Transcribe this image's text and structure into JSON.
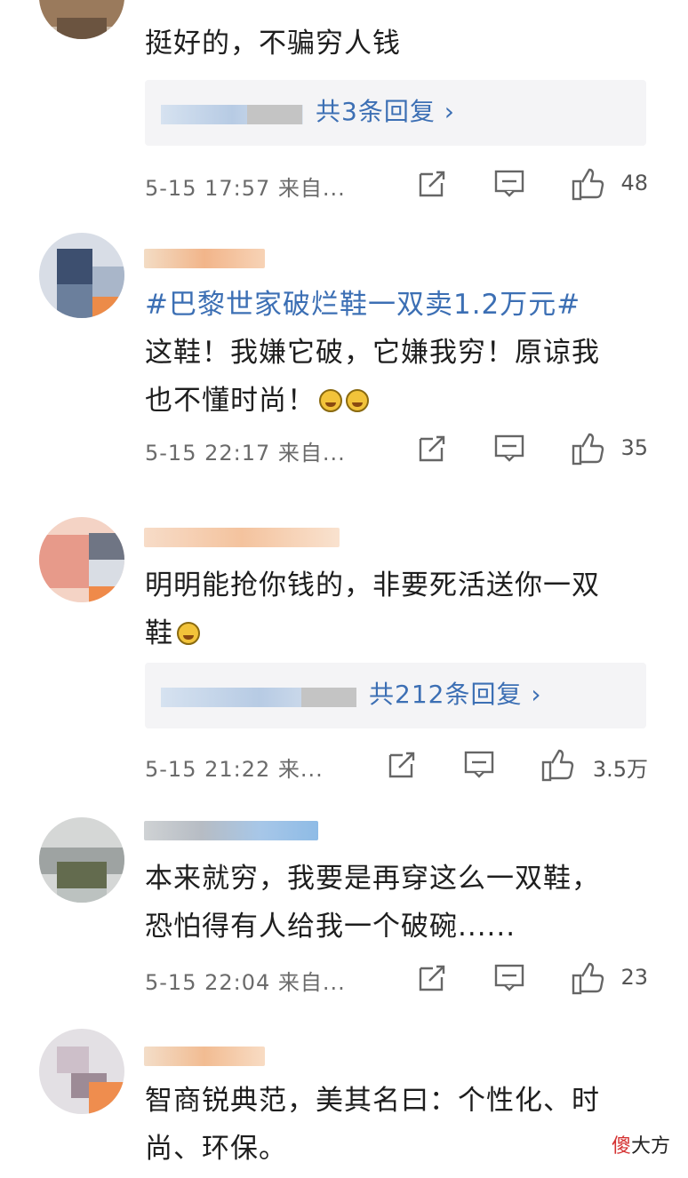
{
  "comments": [
    {
      "text_lines": [
        "挺好的，不骗穷人钱"
      ],
      "reply_link": "共3条回复",
      "meta": {
        "time": "5-15 17:57",
        "source": "来自...",
        "likes": "48"
      }
    },
    {
      "hashtag": "#巴黎世家破烂鞋一双卖1.2万元#",
      "text_lines": [
        "这鞋！我嫌它破，它嫌我穷！原谅我",
        "也不懂时尚！"
      ],
      "meta": {
        "time": "5-15 22:17",
        "source": "来自...",
        "likes": "35"
      }
    },
    {
      "text_lines": [
        "明明能抢你钱的，非要死活送你一双",
        "鞋"
      ],
      "reply_link": "共212条回复",
      "meta": {
        "time": "5-15 21:22",
        "source": "来...",
        "likes": "3.5万"
      }
    },
    {
      "text_lines": [
        "本来就穷，我要是再穿这么一双鞋，",
        "恐怕得有人给我一个破碗......"
      ],
      "meta": {
        "time": "5-15 22:04",
        "source": "来自...",
        "likes": "23"
      }
    },
    {
      "text_lines": [
        "智商锐典范，美其名曰：个性化、时",
        "尚、环保。"
      ]
    }
  ],
  "watermark": {
    "first": "傻",
    "rest": "大方"
  },
  "icons": {
    "share": "share-icon",
    "comment": "comment-icon",
    "like": "thumbs-up-icon"
  },
  "colors": {
    "link": "#3c6fb4",
    "meta": "#6b6b6b",
    "reply_bg": "#f4f4f6"
  }
}
